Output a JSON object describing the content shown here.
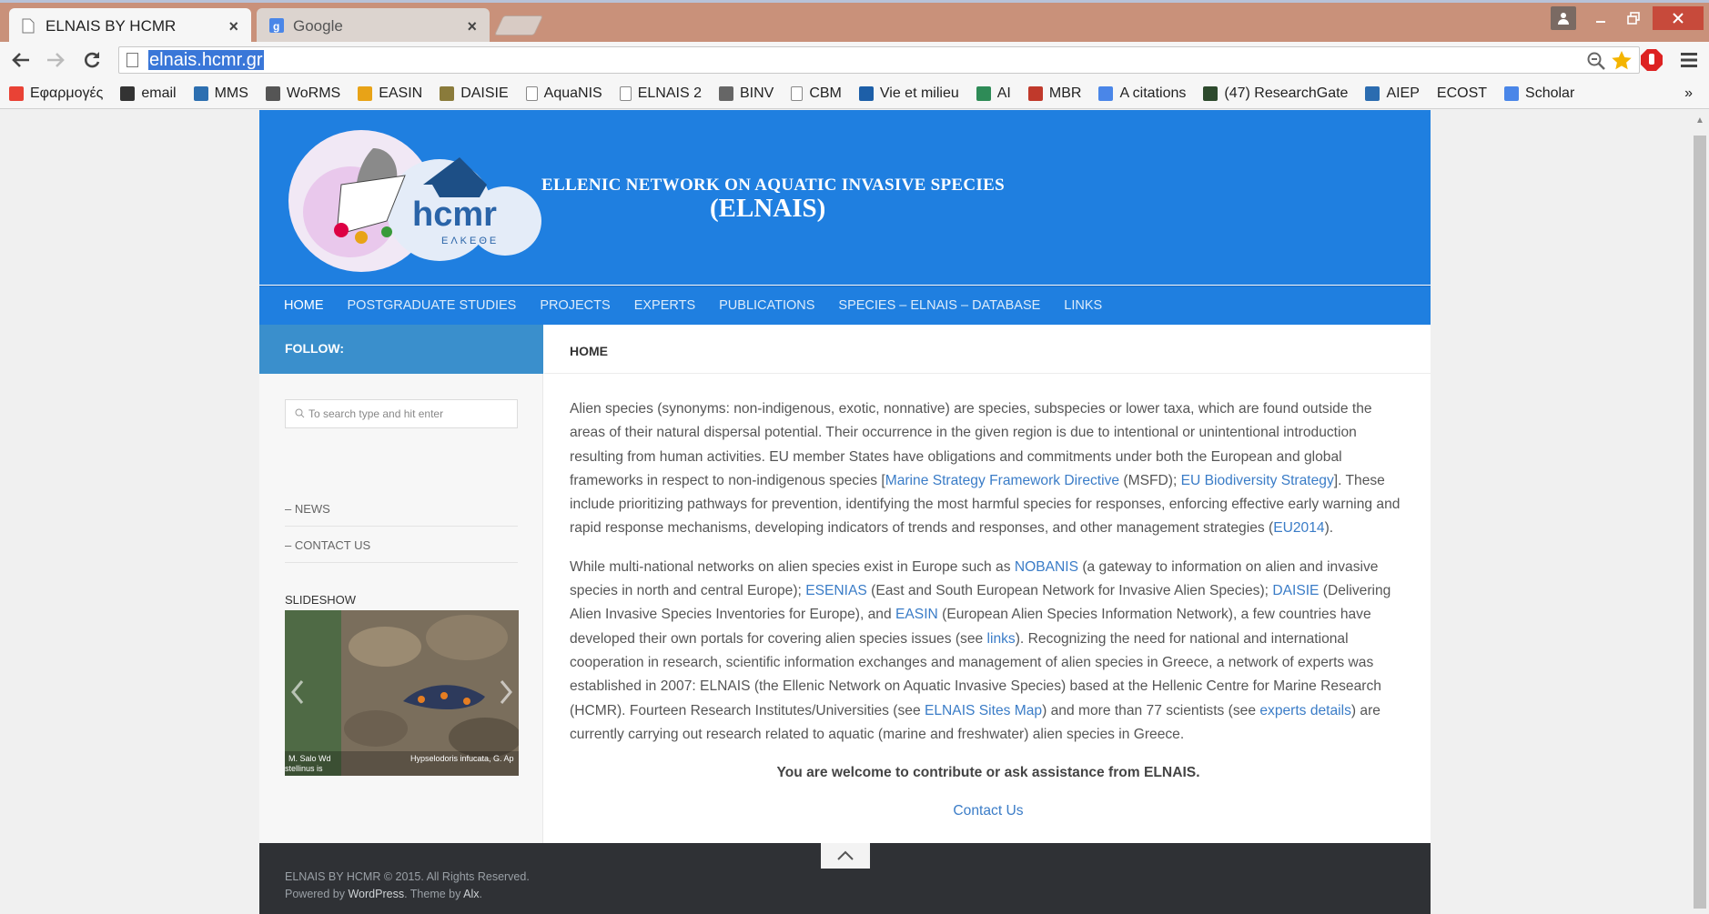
{
  "browser": {
    "tabs": [
      {
        "title": "ELNAIS BY HCMR",
        "close": "×"
      },
      {
        "title": "Google",
        "close": "×"
      }
    ],
    "url": "elnais.hcmr.gr",
    "bookmarks": [
      {
        "label": "Εφαρμογές",
        "icon": "apps-icon",
        "color": "#e94235"
      },
      {
        "label": "email",
        "icon": "email-icon",
        "color": "#333333"
      },
      {
        "label": "MMS",
        "icon": "mms-icon",
        "color": "#2d6fb0"
      },
      {
        "label": "WoRMS",
        "icon": "worms-icon",
        "color": "#555555"
      },
      {
        "label": "EASIN",
        "icon": "easin-icon",
        "color": "#e8a317"
      },
      {
        "label": "DAISIE",
        "icon": "daisie-icon",
        "color": "#8a7b3b"
      },
      {
        "label": "AquaNIS",
        "icon": "page-icon",
        "color": "#bbbbbb"
      },
      {
        "label": "ELNAIS 2",
        "icon": "page-icon",
        "color": "#bbbbbb"
      },
      {
        "label": "BINV",
        "icon": "binv-icon",
        "color": "#666666"
      },
      {
        "label": "CBM",
        "icon": "page-icon",
        "color": "#bbbbbb"
      },
      {
        "label": "Vie et milieu",
        "icon": "book-icon",
        "color": "#1d5fa8"
      },
      {
        "label": "AI",
        "icon": "ai-icon",
        "color": "#2e8b57"
      },
      {
        "label": "MBR",
        "icon": "mbr-icon",
        "color": "#c0392b"
      },
      {
        "label": "A citations",
        "icon": "scholar-icon",
        "color": "#4a86e8"
      },
      {
        "label": "(47) ResearchGate",
        "icon": "researchgate-icon",
        "color": "#2d4a2d"
      },
      {
        "label": "AIEP",
        "icon": "aiep-icon",
        "color": "#2b6cb0"
      },
      {
        "label": "ECOST",
        "icon": "none",
        "color": "transparent"
      },
      {
        "label": "Scholar",
        "icon": "scholar-icon",
        "color": "#4a86e8"
      }
    ],
    "more_bookmarks": "»"
  },
  "site": {
    "title": "ELLENIC NETWORK ON AQUATIC INVASIVE SPECIES",
    "subtitle": "(ELNAIS)",
    "logo_text": "hcmr",
    "logo_subtext": "ΕΛΚΕΘΕ",
    "nav": [
      "HOME",
      "POSTGRADUATE STUDIES",
      "PROJECTS",
      "EXPERTS",
      "PUBLICATIONS",
      "SPECIES – ELNAIS – DATABASE",
      "LINKS"
    ],
    "accent": "#1f7fe0"
  },
  "sidebar": {
    "follow": "FOLLOW:",
    "search_placeholder": "To search type and hit enter",
    "menu": [
      "NEWS",
      "CONTACT US"
    ],
    "slideshow_title": "SLIDESHOW",
    "slide_caption_left": "M. Salo Wd",
    "slide_caption_left2": "stellinus is",
    "slide_caption_right": "Hypselodoris infucata, G. Ap"
  },
  "content": {
    "heading": "HOME",
    "p1_a": "Alien species (synonyms: non-indigenous, exotic, nonnative) are species, subspecies or lower taxa, which are found outside the areas of their natural dispersal potential. Their occurrence in the given region is due to intentional or unintentional introduction resulting from human activities.  EU member States have obligations and commitments under both the European and global frameworks in respect to non-indigenous species [",
    "p1_link1": "Marine Strategy Framework Directive",
    "p1_b": " (MSFD); ",
    "p1_link2": "EU Biodiversity Strategy",
    "p1_c": "]. These include prioritizing pathways for prevention, identifying the most harmful species for responses, enforcing effective early warning and rapid response mechanisms, developing indicators of trends and responses, and other management strategies (",
    "p1_link3": "EU2014",
    "p1_d": ").",
    "p2_a": "While multi-national networks on alien species exist in Europe such as ",
    "p2_link1": "NOBANIS",
    "p2_b": " (a gateway to information on alien and invasive species in north and central Europe); ",
    "p2_link2": "ESENIAS",
    "p2_c": " (East and South European Network for Invasive Alien Species); ",
    "p2_link3": "DAISIE",
    "p2_d": " (Delivering Alien Invasive Species Inventories for Europe), and ",
    "p2_link4": "EASIN",
    "p2_e": " (European Alien Species Information Network), a few countries have developed their own portals for covering alien species issues  (see ",
    "p2_link5": "links",
    "p2_f": "). Recognizing the need for national and international cooperation in research, scientific information exchanges and management of alien species in Greece, a network of experts was established in 2007: ELNAIS (the Ellenic Network on Aquatic Invasive Species) based at the Hellenic Centre for Marine Research (HCMR). Fourteen Research Institutes/Universities (see ",
    "p2_link6": "ELNAIS Sites Map",
    "p2_g": ") and more than 77 scientists (see ",
    "p2_link7": "experts details",
    "p2_h": ") are currently carrying out research related to aquatic (marine and freshwater) alien species in Greece.",
    "welcome": "You are welcome to contribute or ask assistance from ELNAIS.",
    "contact": "Contact Us"
  },
  "footer": {
    "copyright": "ELNAIS BY HCMR © 2015. All Rights Reserved.",
    "powered_prefix": "Powered by ",
    "powered_link": "WordPress",
    "theme_prefix": ". Theme by ",
    "theme_link": "Alx",
    "end": "."
  }
}
